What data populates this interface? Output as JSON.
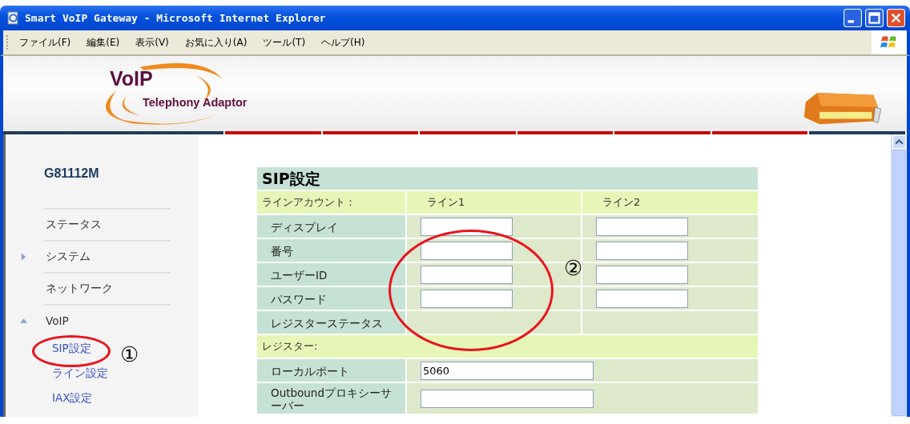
{
  "window": {
    "title": "Smart VoIP Gateway - Microsoft Internet Explorer"
  },
  "menu": [
    "ファイル(F)",
    "編集(E)",
    "表示(V)",
    "お気に入り(A)",
    "ツール(T)",
    "ヘルプ(H)"
  ],
  "banner": {
    "logo_title": "VoIP",
    "logo_subtitle": "Telephony Adaptor"
  },
  "sidebar": {
    "device": "G81112M",
    "items": [
      {
        "label": "ステータス",
        "kind": "link"
      },
      {
        "label": "システム",
        "kind": "group",
        "expanded": false
      },
      {
        "label": "ネットワーク",
        "kind": "link"
      },
      {
        "label": "VoIP",
        "kind": "group",
        "expanded": true,
        "children": [
          {
            "label": "SIP設定"
          },
          {
            "label": "ライン設定"
          },
          {
            "label": "IAX設定"
          }
        ]
      }
    ]
  },
  "sip": {
    "title": "SIP設定",
    "sections": [
      {
        "heading": "ラインアカウント：",
        "columns": [
          "ライン1",
          "ライン2"
        ],
        "rows": [
          {
            "label": "ディスプレイ",
            "kind": "two-fields"
          },
          {
            "label": "番号",
            "kind": "two-fields"
          },
          {
            "label": "ユーザーID",
            "kind": "two-fields"
          },
          {
            "label": "パスワード",
            "kind": "two-fields"
          },
          {
            "label": "レジスターステータス",
            "kind": "empty"
          }
        ]
      },
      {
        "heading": "レジスター:",
        "rows": [
          {
            "label": "ローカルポート",
            "kind": "wide-field",
            "value": "5060"
          },
          {
            "label": "Outboundプロキシーサーバー",
            "kind": "wide-field"
          }
        ]
      }
    ]
  },
  "annotations": [
    {
      "text": "①"
    },
    {
      "text": "②"
    }
  ]
}
